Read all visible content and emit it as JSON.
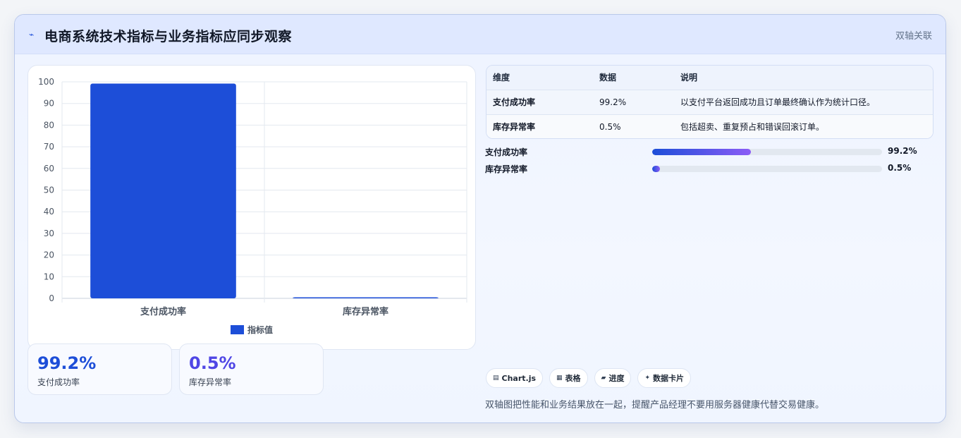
{
  "header": {
    "icon": "pulse-icon",
    "title": "电商系统技术指标与业务指标应同步观察",
    "badge": "双轴关联"
  },
  "chart_data": {
    "type": "bar",
    "categories": [
      "支付成功率",
      "库存异常率"
    ],
    "series": [
      {
        "name": "指标值",
        "values": [
          99.2,
          0.5
        ],
        "color": "#1d4ed8"
      }
    ],
    "yticks": [
      "100",
      "90",
      "80",
      "70",
      "60",
      "50",
      "40",
      "30",
      "20",
      "10",
      "0"
    ],
    "ylim": [
      0,
      100
    ],
    "grid": true,
    "legend": "bottom"
  },
  "stats": [
    {
      "value": "99.2%",
      "label": "支付成功率",
      "color": "#1d4ed8"
    },
    {
      "value": "0.5%",
      "label": "库存异常率",
      "color": "#4f46e5"
    }
  ],
  "table": {
    "headers": [
      "维度",
      "数据",
      "说明"
    ],
    "rows": [
      [
        "支付成功率",
        "99.2%",
        "以支付平台返回成功且订单最终确认作为统计口径。"
      ],
      [
        "库存异常率",
        "0.5%",
        "包括超卖、重复预占和错误回滚订单。"
      ]
    ]
  },
  "progress": [
    {
      "label": "支付成功率",
      "value_text": "99.2%",
      "percent": 99.2
    },
    {
      "label": "库存异常率",
      "value_text": "0.5%",
      "percent": 0.5
    }
  ],
  "tags": [
    {
      "icon": "chart-icon",
      "glyph": "▤",
      "label": "Chart.js"
    },
    {
      "icon": "table-icon",
      "glyph": "▦",
      "label": "表格"
    },
    {
      "icon": "progress-icon",
      "glyph": "▰",
      "label": "进度"
    },
    {
      "icon": "sparkle-icon",
      "glyph": "✦",
      "label": "数据卡片"
    }
  ],
  "footnote": "双轴图把性能和业务结果放在一起，提醒产品经理不要用服务器健康代替交易健康。"
}
